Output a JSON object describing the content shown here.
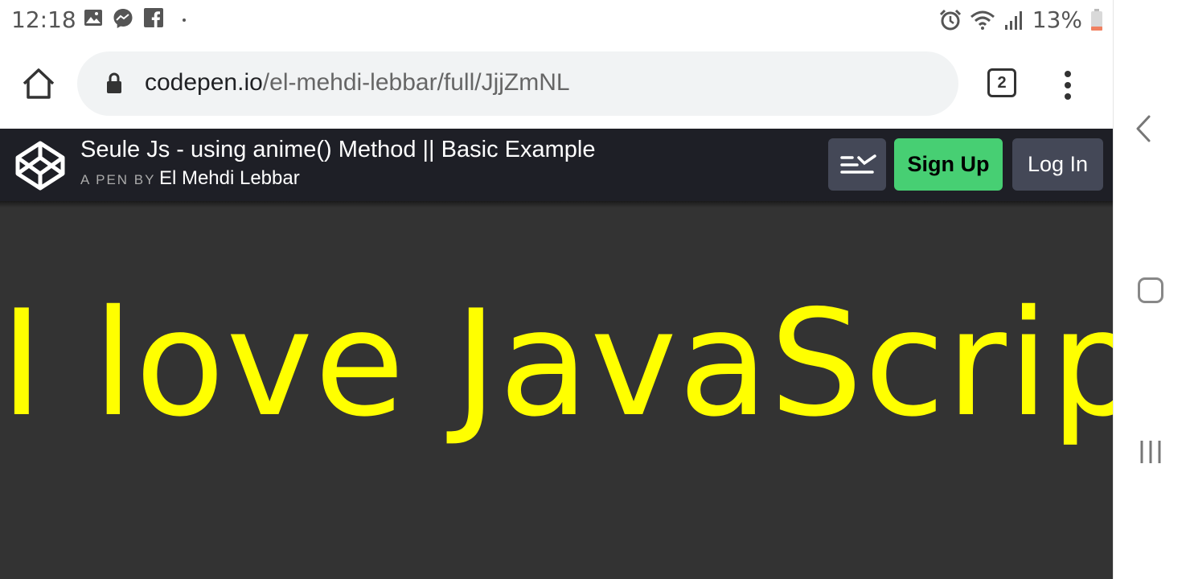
{
  "status_bar": {
    "time": "12:18",
    "left_icons": [
      "gallery-icon",
      "messenger-icon",
      "facebook-icon",
      "dot-icon"
    ],
    "right_icons": [
      "alarm-icon",
      "wifi-icon",
      "signal-icon",
      "battery-icon"
    ],
    "battery_text": "13%"
  },
  "browser": {
    "url_host": "codepen.io",
    "url_path": "/el-mehdi-lebbar/full/JjjZmNL",
    "tab_count": "2"
  },
  "codepen": {
    "title": "Seule Js - using anime() Method || Basic Example",
    "by_prefix": "A PEN BY",
    "author": "El Mehdi Lebbar",
    "signup_label": "Sign Up",
    "login_label": "Log In"
  },
  "preview": {
    "text": "I love JavaScript",
    "text_color": "#ffff00",
    "background": "#333333"
  },
  "colors": {
    "header_bg": "#1e1f26",
    "signup_bg": "#47cf73",
    "button_bg": "#444857"
  }
}
